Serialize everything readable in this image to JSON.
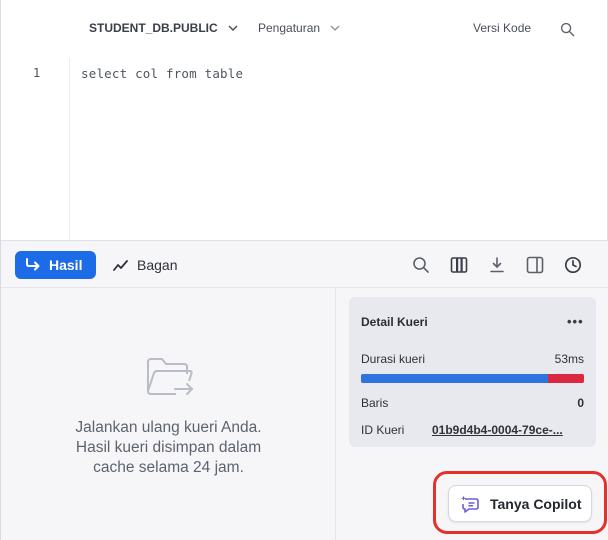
{
  "toolbar": {
    "database": "STUDENT_DB.PUBLIC",
    "settings": "Pengaturan",
    "code_versions": "Versi Kode"
  },
  "editor": {
    "line_number": "1",
    "code": "select col from table"
  },
  "results": {
    "tabs": [
      {
        "label": "Hasil",
        "active": true
      },
      {
        "label": "Bagan",
        "active": false
      }
    ],
    "toolbar_icons": [
      "search-icon",
      "columns-icon",
      "download-icon",
      "split-panel-icon",
      "history-icon"
    ],
    "empty_state": {
      "icon": "folder-arrow-icon",
      "lines": [
        "Jalankan ulang kueri Anda.",
        "Hasil kueri disimpan dalam",
        "cache selama 24 jam."
      ]
    }
  },
  "query_details": {
    "title": "Detail Kueri",
    "duration_label": "Durasi kueri",
    "duration_value": "53ms",
    "duration_bar": {
      "execution_fraction": 0.84,
      "other_fraction": 0.16
    },
    "rows_label": "Baris",
    "rows_value": "0",
    "query_id_label": "ID Kueri",
    "query_id_value": "01b9d4b4-0004-79ce-..."
  },
  "copilot": {
    "label": "Tanya Copilot"
  },
  "colors": {
    "accent": "#1c6ce8",
    "bar_execution": "#2f73e0",
    "bar_other": "#d9283f",
    "highlight_ring": "#e4322a"
  }
}
